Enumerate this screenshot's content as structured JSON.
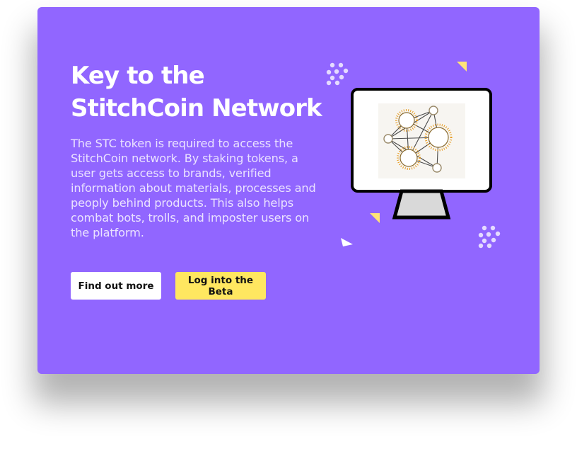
{
  "hero": {
    "title": "Key to the StitchCoin Network",
    "description": "The STC token is required to access the StitchCoin network. By staking tokens, a user gets access to brands, verified information about materials, processes and peoply behind products. This also helps combat bots, trolls, and imposter users on the platform."
  },
  "actions": {
    "find_out_more_label": "Find out more",
    "login_beta_label": "Log into the Beta"
  },
  "illustration": {
    "icon": "monitor-network-icon",
    "decorations": [
      "dot-cluster-icon",
      "triangle-confetti-icon"
    ]
  },
  "colors": {
    "card_background": "#9166ff",
    "primary_button": "#ffffff",
    "accent_button": "#ffe760",
    "accent_confetti": "#ffe377",
    "text_light": "#ffffff"
  }
}
